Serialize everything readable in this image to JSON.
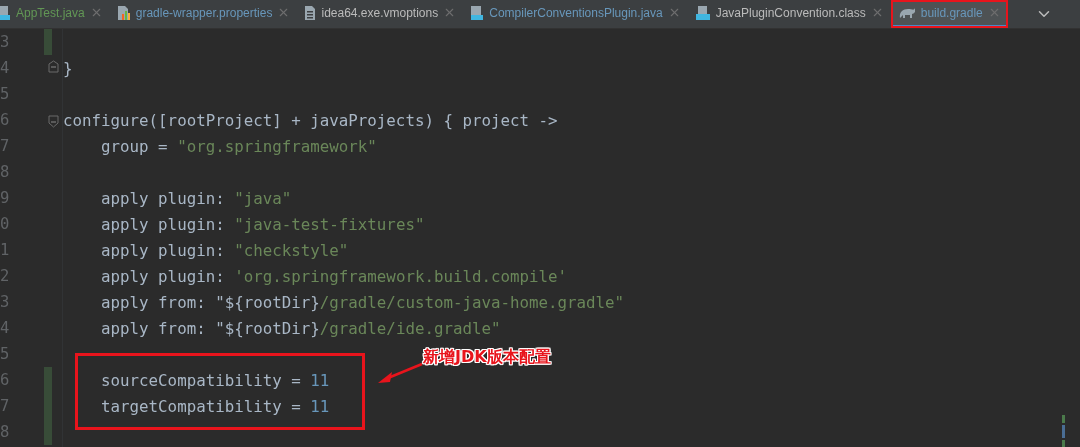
{
  "tabs": [
    {
      "label": "AppTest.java",
      "kind": "java",
      "color": "#629755",
      "selected": false
    },
    {
      "label": "gradle-wrapper.properties",
      "kind": "properties",
      "color": "#6897bb",
      "selected": false
    },
    {
      "label": "idea64.exe.vmoptions",
      "kind": "text",
      "color": "#bbbbbb",
      "selected": false
    },
    {
      "label": "CompilerConventionsPlugin.java",
      "kind": "java",
      "color": "#6897bb",
      "selected": false
    },
    {
      "label": "JavaPluginConvention.class",
      "kind": "class",
      "color": "#bbbbbb",
      "selected": false
    },
    {
      "label": "build.gradle",
      "kind": "gradle",
      "color": "#6897bb",
      "selected": true,
      "highlighted": true
    }
  ],
  "lines": [
    {
      "number": "3",
      "changed": true
    },
    {
      "number": "4",
      "kind": "fold-end",
      "tokens": [
        {
          "kind": "plain",
          "text": "}"
        }
      ]
    },
    {
      "number": "5"
    },
    {
      "number": "6",
      "kind": "fold-start",
      "tokens": [
        {
          "kind": "plain",
          "text": "configure([rootProject] + javaProjects) { project ->"
        }
      ]
    },
    {
      "number": "7",
      "tokens": [
        {
          "kind": "plain",
          "text": "    group = "
        },
        {
          "kind": "string",
          "text": "\"org.springframework\""
        }
      ]
    },
    {
      "number": "8"
    },
    {
      "number": "9",
      "tokens": [
        {
          "kind": "plain",
          "text": "    apply plugin: "
        },
        {
          "kind": "string",
          "text": "\"java\""
        }
      ]
    },
    {
      "number": "0",
      "tokens": [
        {
          "kind": "plain",
          "text": "    apply plugin: "
        },
        {
          "kind": "string",
          "text": "\"java-test-fixtures\""
        }
      ]
    },
    {
      "number": "1",
      "tokens": [
        {
          "kind": "plain",
          "text": "    apply plugin: "
        },
        {
          "kind": "string",
          "text": "\"checkstyle\""
        }
      ]
    },
    {
      "number": "2",
      "tokens": [
        {
          "kind": "plain",
          "text": "    apply plugin: "
        },
        {
          "kind": "string",
          "text": "'org.springframework.build.compile'"
        }
      ]
    },
    {
      "number": "3",
      "tokens": [
        {
          "kind": "plain",
          "text": "    apply from: \"${rootDir}"
        },
        {
          "kind": "string",
          "text": "/gradle/custom-java-home.gradle\""
        }
      ]
    },
    {
      "number": "4",
      "tokens": [
        {
          "kind": "plain",
          "text": "    apply from: \"${rootDir}"
        },
        {
          "kind": "string",
          "text": "/gradle/ide.gradle\""
        }
      ]
    },
    {
      "number": "5"
    },
    {
      "number": "6",
      "changed": true,
      "tokens": [
        {
          "kind": "plain",
          "text": "    sourceCompatibility = "
        },
        {
          "kind": "number",
          "text": "11"
        }
      ]
    },
    {
      "number": "7",
      "changed": true,
      "tokens": [
        {
          "kind": "plain",
          "text": "    targetCompatibility = "
        },
        {
          "kind": "number",
          "text": "11"
        }
      ]
    },
    {
      "number": "8",
      "changed": true
    }
  ],
  "annotation": {
    "label": "新增JDK版本配置"
  }
}
